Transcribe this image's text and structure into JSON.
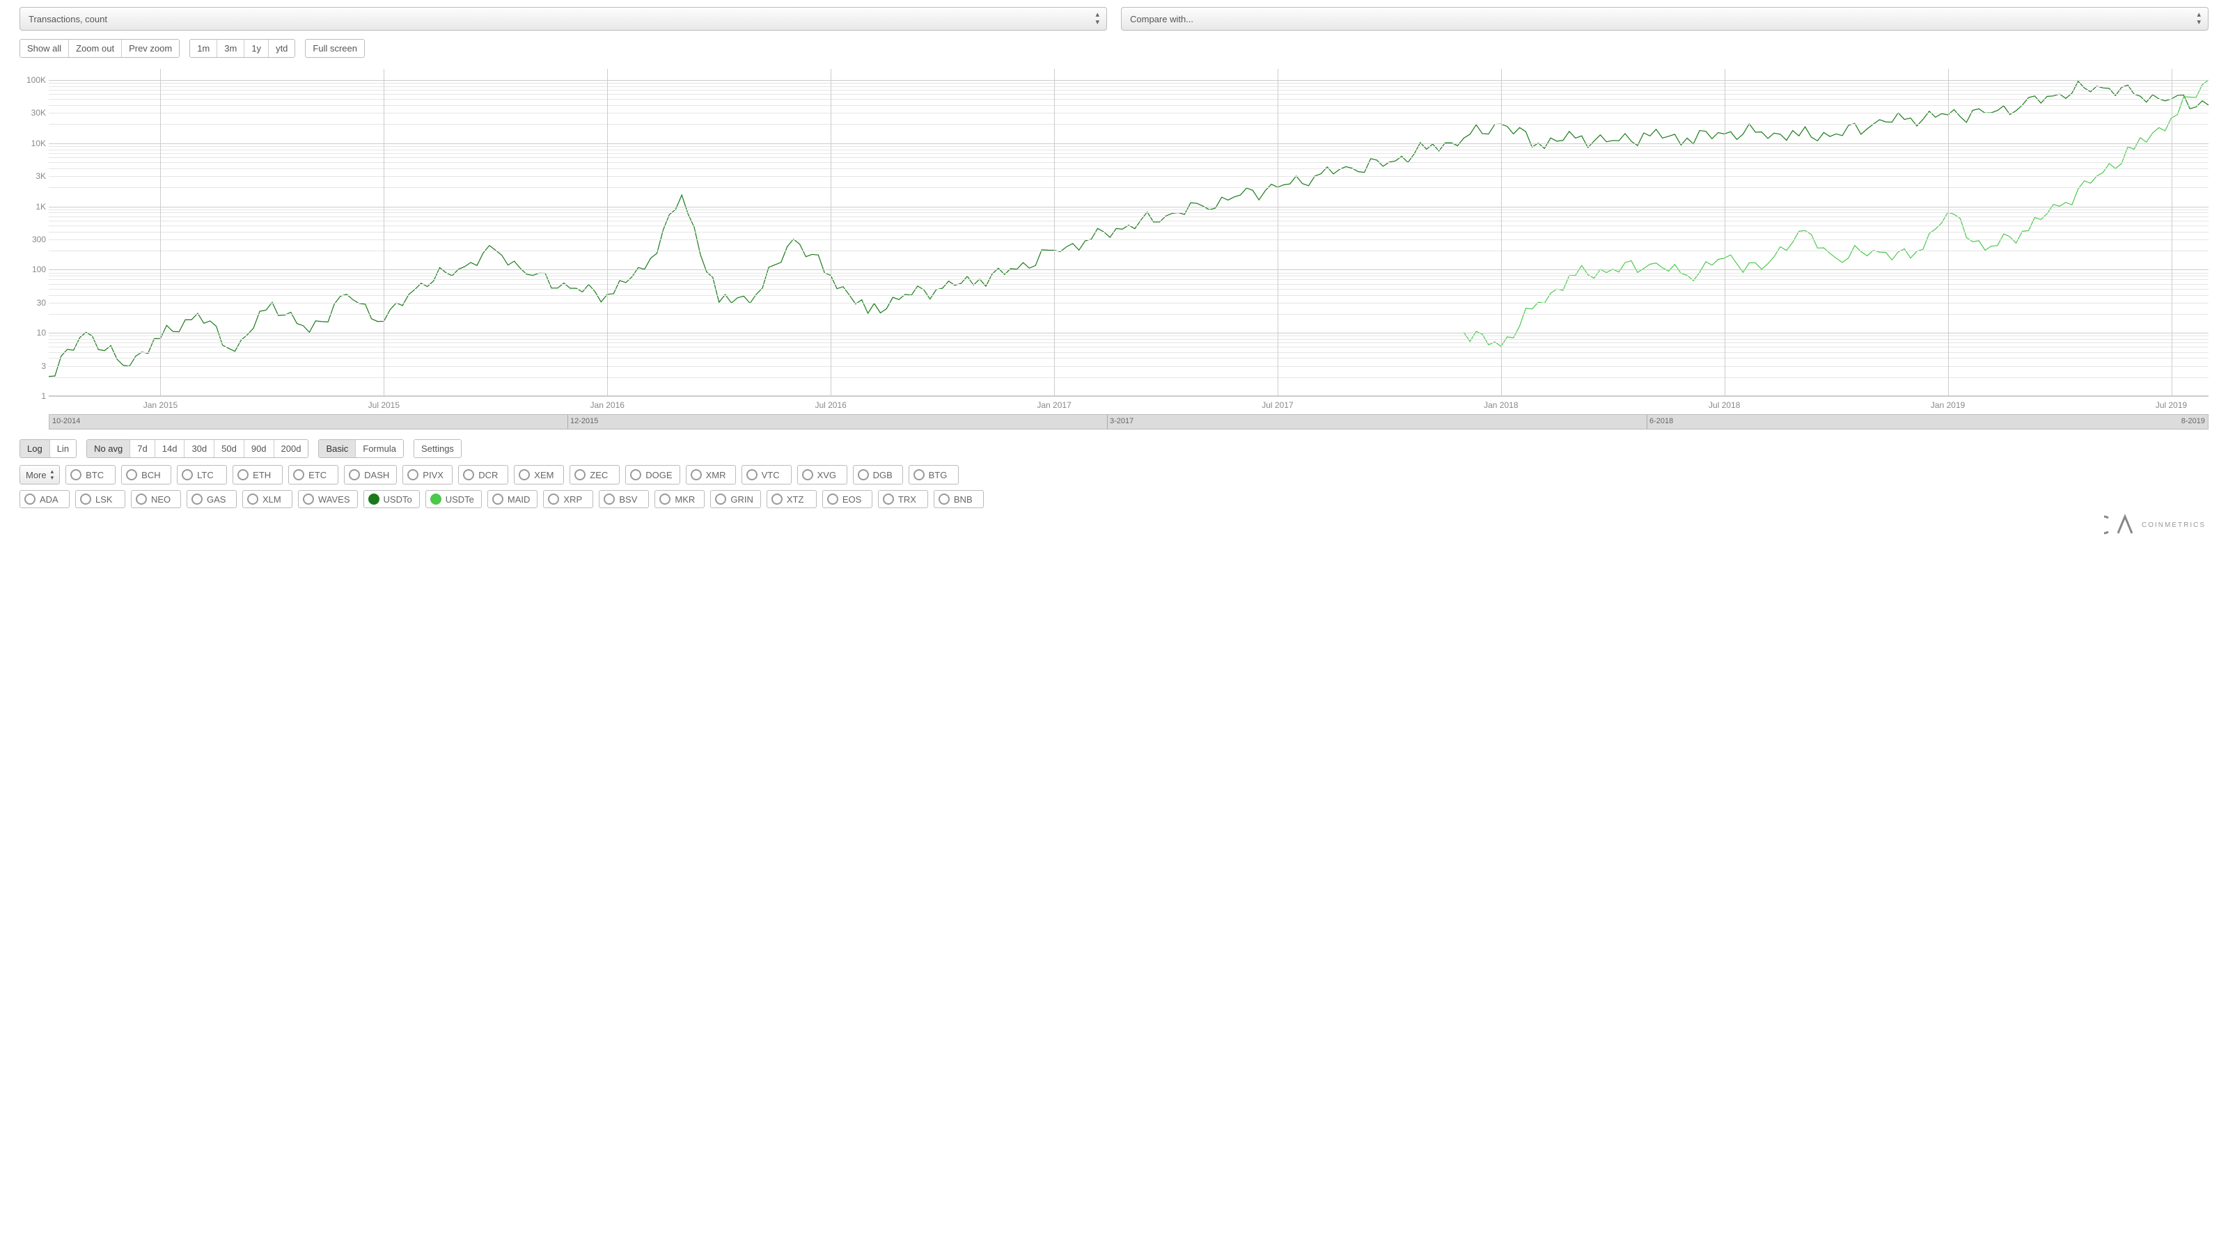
{
  "header": {
    "metric_select": "Transactions, count",
    "compare_select": "Compare with..."
  },
  "toolbar": {
    "show_all": "Show all",
    "zoom_out": "Zoom out",
    "prev_zoom": "Prev zoom",
    "range_1m": "1m",
    "range_3m": "3m",
    "range_1y": "1y",
    "range_ytd": "ytd",
    "fullscreen": "Full screen"
  },
  "scale": {
    "log": "Log",
    "lin": "Lin"
  },
  "avg": {
    "no_avg": "No avg",
    "d7": "7d",
    "d14": "14d",
    "d30": "30d",
    "d50": "50d",
    "d90": "90d",
    "d200": "200d"
  },
  "mode": {
    "basic": "Basic",
    "formula": "Formula"
  },
  "settings": "Settings",
  "more": "More",
  "assets_row1": [
    "BTC",
    "BCH",
    "LTC",
    "ETH",
    "ETC",
    "DASH",
    "PIVX",
    "DCR",
    "XEM",
    "ZEC",
    "DOGE",
    "XMR",
    "VTC",
    "XVG",
    "DGB",
    "BTG"
  ],
  "assets_row2": [
    "ADA",
    "LSK",
    "NEO",
    "GAS",
    "XLM",
    "WAVES",
    "USDTo",
    "USDTe",
    "MAID",
    "XRP",
    "BSV",
    "MKR",
    "GRIN",
    "XTZ",
    "EOS",
    "TRX",
    "BNB"
  ],
  "selected_assets": {
    "USDTo": "dark",
    "USDTe": "light"
  },
  "logo": "COINMETRICS",
  "chart_data": {
    "type": "line",
    "title": "",
    "xlabel": "",
    "ylabel": "",
    "yscale": "log",
    "ylim": [
      1,
      150000
    ],
    "y_ticks": [
      "1",
      "3",
      "10",
      "30",
      "100",
      "300",
      "1K",
      "3K",
      "10K",
      "30K",
      "100K"
    ],
    "x_ticks": [
      "Jan 2015",
      "Jul 2015",
      "Jan 2016",
      "Jul 2016",
      "Jan 2017",
      "Jul 2017",
      "Jan 2018",
      "Jul 2018",
      "Jan 2019",
      "Jul 2019"
    ],
    "x_range": [
      "2014-10",
      "2019-08"
    ],
    "navigator_labels": [
      {
        "pos": 0.0,
        "text": "10-2014"
      },
      {
        "pos": 0.24,
        "text": "12-2015"
      },
      {
        "pos": 0.49,
        "text": "3-2017"
      },
      {
        "pos": 0.74,
        "text": "6-2018"
      },
      {
        "pos": 1.0,
        "text": "8-2019"
      }
    ],
    "series": [
      {
        "name": "USDTo",
        "color": "#1a7a1a",
        "points": [
          {
            "x": "2014-10",
            "y": 2
          },
          {
            "x": "2014-11",
            "y": 10
          },
          {
            "x": "2014-12",
            "y": 3
          },
          {
            "x": "2015-01",
            "y": 8
          },
          {
            "x": "2015-02",
            "y": 20
          },
          {
            "x": "2015-03",
            "y": 5
          },
          {
            "x": "2015-04",
            "y": 30
          },
          {
            "x": "2015-05",
            "y": 10
          },
          {
            "x": "2015-06",
            "y": 40
          },
          {
            "x": "2015-07",
            "y": 15
          },
          {
            "x": "2015-08",
            "y": 60
          },
          {
            "x": "2015-09",
            "y": 100
          },
          {
            "x": "2015-10",
            "y": 200
          },
          {
            "x": "2015-11",
            "y": 80
          },
          {
            "x": "2015-12",
            "y": 50
          },
          {
            "x": "2016-01",
            "y": 40
          },
          {
            "x": "2016-02",
            "y": 100
          },
          {
            "x": "2016-03",
            "y": 1500
          },
          {
            "x": "2016-04",
            "y": 30
          },
          {
            "x": "2016-05",
            "y": 40
          },
          {
            "x": "2016-06",
            "y": 300
          },
          {
            "x": "2016-07",
            "y": 80
          },
          {
            "x": "2016-08",
            "y": 20
          },
          {
            "x": "2016-09",
            "y": 40
          },
          {
            "x": "2016-10",
            "y": 50
          },
          {
            "x": "2016-11",
            "y": 70
          },
          {
            "x": "2016-12",
            "y": 100
          },
          {
            "x": "2017-01",
            "y": 200
          },
          {
            "x": "2017-02",
            "y": 300
          },
          {
            "x": "2017-03",
            "y": 500
          },
          {
            "x": "2017-04",
            "y": 700
          },
          {
            "x": "2017-05",
            "y": 1000
          },
          {
            "x": "2017-06",
            "y": 1500
          },
          {
            "x": "2017-07",
            "y": 2000
          },
          {
            "x": "2017-08",
            "y": 3000
          },
          {
            "x": "2017-09",
            "y": 4000
          },
          {
            "x": "2017-10",
            "y": 5000
          },
          {
            "x": "2017-11",
            "y": 8000
          },
          {
            "x": "2017-12",
            "y": 12000
          },
          {
            "x": "2018-01",
            "y": 20000
          },
          {
            "x": "2018-02",
            "y": 10000
          },
          {
            "x": "2018-03",
            "y": 12000
          },
          {
            "x": "2018-04",
            "y": 11000
          },
          {
            "x": "2018-05",
            "y": 13000
          },
          {
            "x": "2018-06",
            "y": 12000
          },
          {
            "x": "2018-07",
            "y": 14000
          },
          {
            "x": "2018-08",
            "y": 15000
          },
          {
            "x": "2018-09",
            "y": 13000
          },
          {
            "x": "2018-10",
            "y": 14000
          },
          {
            "x": "2018-11",
            "y": 20000
          },
          {
            "x": "2018-12",
            "y": 25000
          },
          {
            "x": "2019-01",
            "y": 28000
          },
          {
            "x": "2019-02",
            "y": 30000
          },
          {
            "x": "2019-03",
            "y": 40000
          },
          {
            "x": "2019-04",
            "y": 60000
          },
          {
            "x": "2019-05",
            "y": 80000
          },
          {
            "x": "2019-06",
            "y": 60000
          },
          {
            "x": "2019-07",
            "y": 50000
          },
          {
            "x": "2019-08",
            "y": 40000
          }
        ]
      },
      {
        "name": "USDTe",
        "color": "#4ac94a",
        "points": [
          {
            "x": "2017-12",
            "y": 10
          },
          {
            "x": "2018-01",
            "y": 6
          },
          {
            "x": "2018-02",
            "y": 30
          },
          {
            "x": "2018-03",
            "y": 80
          },
          {
            "x": "2018-04",
            "y": 100
          },
          {
            "x": "2018-05",
            "y": 120
          },
          {
            "x": "2018-06",
            "y": 80
          },
          {
            "x": "2018-07",
            "y": 150
          },
          {
            "x": "2018-08",
            "y": 100
          },
          {
            "x": "2018-09",
            "y": 400
          },
          {
            "x": "2018-10",
            "y": 150
          },
          {
            "x": "2018-11",
            "y": 200
          },
          {
            "x": "2018-12",
            "y": 150
          },
          {
            "x": "2019-01",
            "y": 800
          },
          {
            "x": "2019-02",
            "y": 200
          },
          {
            "x": "2019-03",
            "y": 400
          },
          {
            "x": "2019-04",
            "y": 1000
          },
          {
            "x": "2019-05",
            "y": 3000
          },
          {
            "x": "2019-06",
            "y": 8000
          },
          {
            "x": "2019-07",
            "y": 25000
          },
          {
            "x": "2019-08",
            "y": 100000
          }
        ]
      }
    ]
  }
}
